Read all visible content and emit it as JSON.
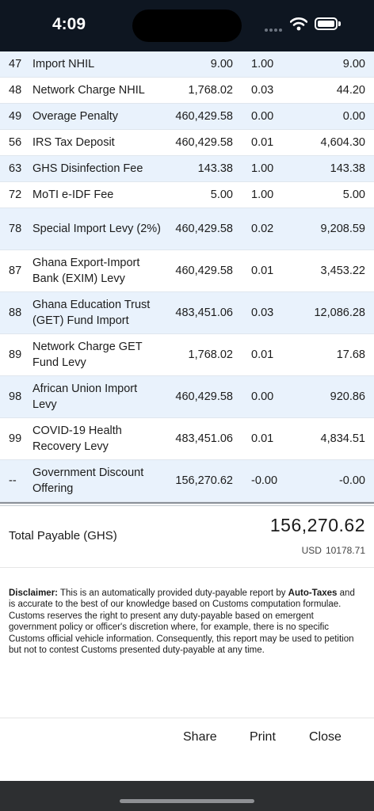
{
  "status_bar": {
    "time": "4:09"
  },
  "tax_rows": [
    {
      "code": "47",
      "description": "Import NHIL",
      "base": "9.00",
      "rate": "1.00",
      "amount": "9.00"
    },
    {
      "code": "48",
      "description": "Network Charge NHIL",
      "base": "1,768.02",
      "rate": "0.03",
      "amount": "44.20"
    },
    {
      "code": "49",
      "description": "Overage Penalty",
      "base": "460,429.58",
      "rate": "0.00",
      "amount": "0.00"
    },
    {
      "code": "56",
      "description": "IRS Tax Deposit",
      "base": "460,429.58",
      "rate": "0.01",
      "amount": "4,604.30"
    },
    {
      "code": "63",
      "description": "GHS Disinfection Fee",
      "base": "143.38",
      "rate": "1.00",
      "amount": "143.38"
    },
    {
      "code": "72",
      "description": "MoTI e-IDF Fee",
      "base": "5.00",
      "rate": "1.00",
      "amount": "5.00"
    },
    {
      "code": "78",
      "description": "Special Import Levy (2%)",
      "base": "460,429.58",
      "rate": "0.02",
      "amount": "9,208.59"
    },
    {
      "code": "87",
      "description": "Ghana Export-Import Bank (EXIM) Levy",
      "base": "460,429.58",
      "rate": "0.01",
      "amount": "3,453.22"
    },
    {
      "code": "88",
      "description": "Ghana Education Trust (GET) Fund Import",
      "base": "483,451.06",
      "rate": "0.03",
      "amount": "12,086.28"
    },
    {
      "code": "89",
      "description": "Network Charge GET Fund Levy",
      "base": "1,768.02",
      "rate": "0.01",
      "amount": "17.68"
    },
    {
      "code": "98",
      "description": "African Union Import Levy",
      "base": "460,429.58",
      "rate": "0.00",
      "amount": "920.86"
    },
    {
      "code": "99",
      "description": "COVID-19 Health Recovery Levy",
      "base": "483,451.06",
      "rate": "0.01",
      "amount": "4,834.51"
    },
    {
      "code": "--",
      "description": "Government Discount Offering",
      "base": "156,270.62",
      "rate": "-0.00",
      "amount": "-0.00"
    }
  ],
  "summary": {
    "total_label": "Total Payable (GHS)",
    "total_value": "156,270.62",
    "usd_prefix": "USD",
    "usd_value": "10178.71"
  },
  "disclaimer": {
    "label": "Disclaimer:",
    "text_before": "This is an automatically provided duty-payable report by",
    "brand": "Auto-Taxes",
    "text_after": "and is accurate to the best of our knowledge based on Customs computation formulae. Customs reserves the right to present any duty-payable based on emergent government policy or officer's discretion where, for example, there is no specific Customs official vehicle information. Consequently, this report may be used to petition but not to contest Customs presented duty-payable at any time."
  },
  "actions": {
    "share": "Share",
    "print": "Print",
    "close": "Close"
  },
  "colors": {
    "status_bar": "#0e1621",
    "row_alt": "#e9f2fc",
    "home_bar": "#2d2f31"
  }
}
